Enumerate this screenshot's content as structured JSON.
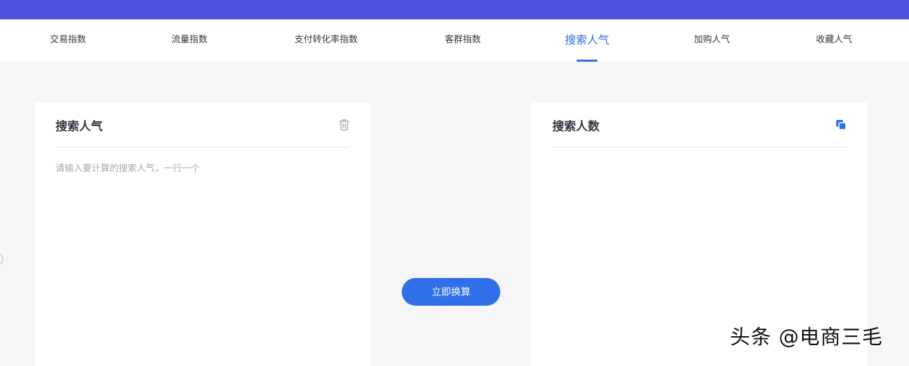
{
  "tabs": [
    {
      "label": "交易指数"
    },
    {
      "label": "流量指数"
    },
    {
      "label": "支付转化率指数"
    },
    {
      "label": "客群指数"
    },
    {
      "label": "搜索人气"
    },
    {
      "label": "加购人气"
    },
    {
      "label": "收藏人气"
    }
  ],
  "active_tab": "搜索人气",
  "left_card": {
    "title": "搜索人气",
    "input_placeholder": "请输入要计算的搜索人气，一行一个",
    "input_value": "",
    "icon": "trash-icon"
  },
  "right_card": {
    "title": "搜索人数",
    "icon": "copy-icon"
  },
  "convert_button": {
    "label": "立即换算"
  },
  "watermark": {
    "text": "头条 @电商三毛"
  },
  "colors": {
    "header_bar": "#5050dc",
    "accent": "#2f6fdc",
    "button": "#2f6fea",
    "background": "#f5f6f8"
  }
}
